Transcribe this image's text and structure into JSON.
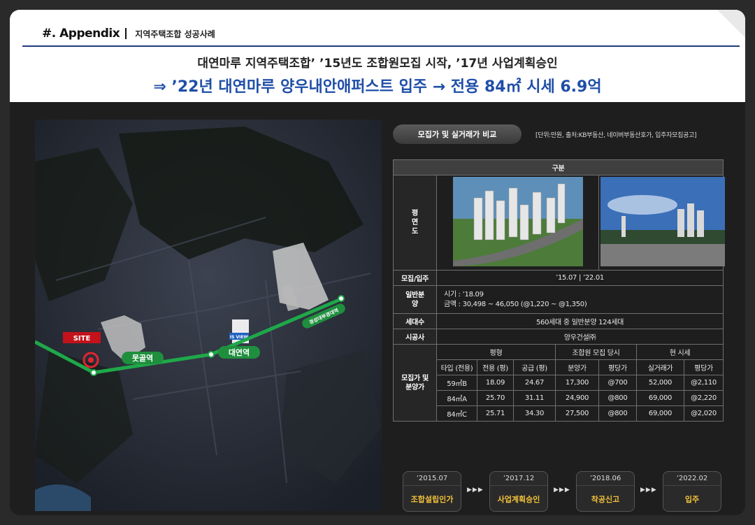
{
  "header": {
    "section": "#.  Appendix",
    "subtitle": "지역주택조합 성공사례",
    "line1": "대연마루 지역주택조합’ ’15년도 조합원모집 시작, ’17년 사업계획승인",
    "line2": "⇒ ’22년 대연마루 양우내안애퍼스트 입주 → 전용 84㎡ 시세 6.9억"
  },
  "map": {
    "site_label": "SITE",
    "stations": [
      "못골역",
      "대연역",
      "경성대부경대역"
    ],
    "building_labels": [
      "IS VIEW"
    ]
  },
  "panel": {
    "pill": "모집가 및 실거래가 비교",
    "note": "[단위:만원, 출처:KB부동산, 네이버부동산호가, 입주자모집공고]",
    "header_label": "구분",
    "rows": {
      "floorplan": "평면도",
      "recruit": "모집/입주",
      "recruit_value": "’15.07 | ’22.01",
      "general": "일반분양",
      "general_time": "시기 : ’18.09",
      "general_price": "금액 : 30,498 ~ 46,050 (@1,220 ~ @1,350)",
      "households": "세대수",
      "households_value": "560세대 중 일반분양 124세대",
      "builder": "시공사",
      "builder_value": "양우건설㈜",
      "price": "모집가 및 분양가"
    },
    "table_headers": {
      "pyeong": "평형",
      "union_time": "조합원 모집 당시",
      "current": "현 시세",
      "cols": [
        "타입 (전용)",
        "전용 (평)",
        "공급 (평)",
        "분양가",
        "평당가",
        "실거래가",
        "평당가"
      ]
    },
    "price_rows": [
      [
        "59㎡B",
        "18.09",
        "24.67",
        "17,300",
        "@700",
        "52,000",
        "@2,110"
      ],
      [
        "84㎡A",
        "25.70",
        "31.11",
        "24,900",
        "@800",
        "69,000",
        "@2,220"
      ],
      [
        "84㎡C",
        "25.71",
        "34.30",
        "27,500",
        "@800",
        "69,000",
        "@2,020"
      ]
    ]
  },
  "timeline": [
    {
      "date": "’2015.07",
      "label": "조합설립인가"
    },
    {
      "date": "’2017.12",
      "label": "사업계획승인"
    },
    {
      "date": "’2018.06",
      "label": "착공신고"
    },
    {
      "date": "’2022.02",
      "label": "입주"
    }
  ],
  "arrow": "▶▶▶"
}
